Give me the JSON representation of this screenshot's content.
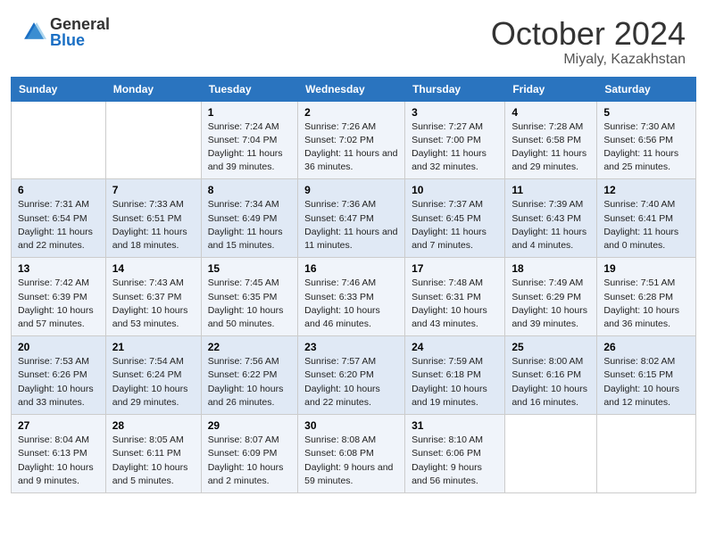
{
  "header": {
    "logo_general": "General",
    "logo_blue": "Blue",
    "month": "October 2024",
    "location": "Miyaly, Kazakhstan"
  },
  "days_of_week": [
    "Sunday",
    "Monday",
    "Tuesday",
    "Wednesday",
    "Thursday",
    "Friday",
    "Saturday"
  ],
  "weeks": [
    [
      {
        "day": "",
        "sunrise": "",
        "sunset": "",
        "daylight": ""
      },
      {
        "day": "",
        "sunrise": "",
        "sunset": "",
        "daylight": ""
      },
      {
        "day": "1",
        "sunrise": "Sunrise: 7:24 AM",
        "sunset": "Sunset: 7:04 PM",
        "daylight": "Daylight: 11 hours and 39 minutes."
      },
      {
        "day": "2",
        "sunrise": "Sunrise: 7:26 AM",
        "sunset": "Sunset: 7:02 PM",
        "daylight": "Daylight: 11 hours and 36 minutes."
      },
      {
        "day": "3",
        "sunrise": "Sunrise: 7:27 AM",
        "sunset": "Sunset: 7:00 PM",
        "daylight": "Daylight: 11 hours and 32 minutes."
      },
      {
        "day": "4",
        "sunrise": "Sunrise: 7:28 AM",
        "sunset": "Sunset: 6:58 PM",
        "daylight": "Daylight: 11 hours and 29 minutes."
      },
      {
        "day": "5",
        "sunrise": "Sunrise: 7:30 AM",
        "sunset": "Sunset: 6:56 PM",
        "daylight": "Daylight: 11 hours and 25 minutes."
      }
    ],
    [
      {
        "day": "6",
        "sunrise": "Sunrise: 7:31 AM",
        "sunset": "Sunset: 6:54 PM",
        "daylight": "Daylight: 11 hours and 22 minutes."
      },
      {
        "day": "7",
        "sunrise": "Sunrise: 7:33 AM",
        "sunset": "Sunset: 6:51 PM",
        "daylight": "Daylight: 11 hours and 18 minutes."
      },
      {
        "day": "8",
        "sunrise": "Sunrise: 7:34 AM",
        "sunset": "Sunset: 6:49 PM",
        "daylight": "Daylight: 11 hours and 15 minutes."
      },
      {
        "day": "9",
        "sunrise": "Sunrise: 7:36 AM",
        "sunset": "Sunset: 6:47 PM",
        "daylight": "Daylight: 11 hours and 11 minutes."
      },
      {
        "day": "10",
        "sunrise": "Sunrise: 7:37 AM",
        "sunset": "Sunset: 6:45 PM",
        "daylight": "Daylight: 11 hours and 7 minutes."
      },
      {
        "day": "11",
        "sunrise": "Sunrise: 7:39 AM",
        "sunset": "Sunset: 6:43 PM",
        "daylight": "Daylight: 11 hours and 4 minutes."
      },
      {
        "day": "12",
        "sunrise": "Sunrise: 7:40 AM",
        "sunset": "Sunset: 6:41 PM",
        "daylight": "Daylight: 11 hours and 0 minutes."
      }
    ],
    [
      {
        "day": "13",
        "sunrise": "Sunrise: 7:42 AM",
        "sunset": "Sunset: 6:39 PM",
        "daylight": "Daylight: 10 hours and 57 minutes."
      },
      {
        "day": "14",
        "sunrise": "Sunrise: 7:43 AM",
        "sunset": "Sunset: 6:37 PM",
        "daylight": "Daylight: 10 hours and 53 minutes."
      },
      {
        "day": "15",
        "sunrise": "Sunrise: 7:45 AM",
        "sunset": "Sunset: 6:35 PM",
        "daylight": "Daylight: 10 hours and 50 minutes."
      },
      {
        "day": "16",
        "sunrise": "Sunrise: 7:46 AM",
        "sunset": "Sunset: 6:33 PM",
        "daylight": "Daylight: 10 hours and 46 minutes."
      },
      {
        "day": "17",
        "sunrise": "Sunrise: 7:48 AM",
        "sunset": "Sunset: 6:31 PM",
        "daylight": "Daylight: 10 hours and 43 minutes."
      },
      {
        "day": "18",
        "sunrise": "Sunrise: 7:49 AM",
        "sunset": "Sunset: 6:29 PM",
        "daylight": "Daylight: 10 hours and 39 minutes."
      },
      {
        "day": "19",
        "sunrise": "Sunrise: 7:51 AM",
        "sunset": "Sunset: 6:28 PM",
        "daylight": "Daylight: 10 hours and 36 minutes."
      }
    ],
    [
      {
        "day": "20",
        "sunrise": "Sunrise: 7:53 AM",
        "sunset": "Sunset: 6:26 PM",
        "daylight": "Daylight: 10 hours and 33 minutes."
      },
      {
        "day": "21",
        "sunrise": "Sunrise: 7:54 AM",
        "sunset": "Sunset: 6:24 PM",
        "daylight": "Daylight: 10 hours and 29 minutes."
      },
      {
        "day": "22",
        "sunrise": "Sunrise: 7:56 AM",
        "sunset": "Sunset: 6:22 PM",
        "daylight": "Daylight: 10 hours and 26 minutes."
      },
      {
        "day": "23",
        "sunrise": "Sunrise: 7:57 AM",
        "sunset": "Sunset: 6:20 PM",
        "daylight": "Daylight: 10 hours and 22 minutes."
      },
      {
        "day": "24",
        "sunrise": "Sunrise: 7:59 AM",
        "sunset": "Sunset: 6:18 PM",
        "daylight": "Daylight: 10 hours and 19 minutes."
      },
      {
        "day": "25",
        "sunrise": "Sunrise: 8:00 AM",
        "sunset": "Sunset: 6:16 PM",
        "daylight": "Daylight: 10 hours and 16 minutes."
      },
      {
        "day": "26",
        "sunrise": "Sunrise: 8:02 AM",
        "sunset": "Sunset: 6:15 PM",
        "daylight": "Daylight: 10 hours and 12 minutes."
      }
    ],
    [
      {
        "day": "27",
        "sunrise": "Sunrise: 8:04 AM",
        "sunset": "Sunset: 6:13 PM",
        "daylight": "Daylight: 10 hours and 9 minutes."
      },
      {
        "day": "28",
        "sunrise": "Sunrise: 8:05 AM",
        "sunset": "Sunset: 6:11 PM",
        "daylight": "Daylight: 10 hours and 5 minutes."
      },
      {
        "day": "29",
        "sunrise": "Sunrise: 8:07 AM",
        "sunset": "Sunset: 6:09 PM",
        "daylight": "Daylight: 10 hours and 2 minutes."
      },
      {
        "day": "30",
        "sunrise": "Sunrise: 8:08 AM",
        "sunset": "Sunset: 6:08 PM",
        "daylight": "Daylight: 9 hours and 59 minutes."
      },
      {
        "day": "31",
        "sunrise": "Sunrise: 8:10 AM",
        "sunset": "Sunset: 6:06 PM",
        "daylight": "Daylight: 9 hours and 56 minutes."
      },
      {
        "day": "",
        "sunrise": "",
        "sunset": "",
        "daylight": ""
      },
      {
        "day": "",
        "sunrise": "",
        "sunset": "",
        "daylight": ""
      }
    ]
  ]
}
